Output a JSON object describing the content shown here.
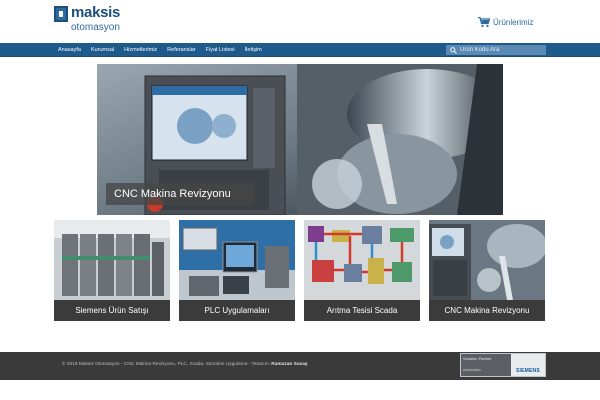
{
  "header": {
    "logo": {
      "name": "maksis",
      "sub": "otomasyon"
    },
    "cart_label": "Ürünlerimiz"
  },
  "nav": {
    "items": [
      "Anasayfa",
      "Kurumsal",
      "Hizmetlerimiz",
      "Referanslar",
      "Fiyat Listesi",
      "İletişim"
    ],
    "search_placeholder": "Ürün Kodu Ara"
  },
  "hero": {
    "caption": "CNC Makina Revizyonu"
  },
  "tiles": [
    {
      "label": "Siemens Ürün Satışı"
    },
    {
      "label": "PLC Uygulamaları"
    },
    {
      "label": "Arıtma Tesisi Scada"
    },
    {
      "label": "CNC Makina Revizyonu"
    }
  ],
  "footer": {
    "copyright": "© 2016 Maksis Otomasyon - CNC Makina Revizyonu, PLC, Scada, Simotion Uygulama - Tasarım:",
    "designer": "Ramazan Savaş",
    "partner": {
      "line1": "Solution Partner",
      "line2": "Automation",
      "brand": "SIEMENS"
    }
  },
  "colors": {
    "nav": "#1f5a8c",
    "brand": "#2c6aa0",
    "footer": "#3a3a3a"
  }
}
